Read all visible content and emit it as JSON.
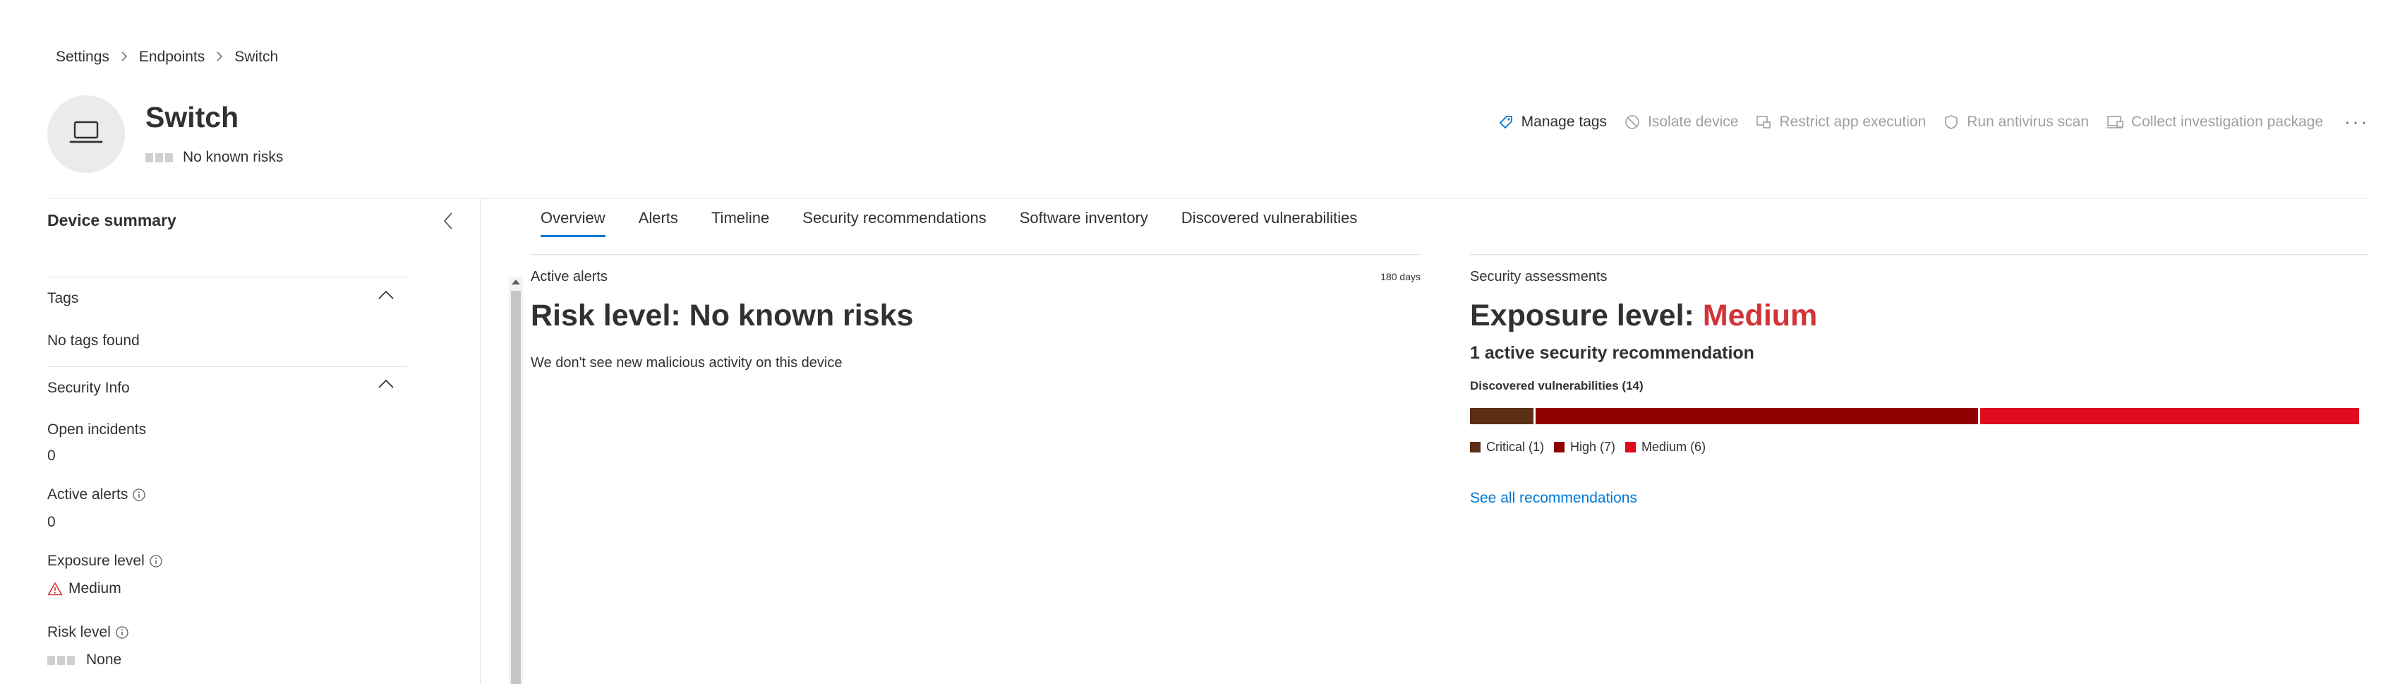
{
  "breadcrumb": [
    "Settings",
    "Endpoints",
    "Switch"
  ],
  "device": {
    "name": "Switch",
    "risk_text": "No known risks",
    "icon": "laptop-icon"
  },
  "actions": [
    {
      "label": "Manage tags",
      "icon": "tag-icon",
      "enabled": true
    },
    {
      "label": "Isolate device",
      "icon": "block-icon",
      "enabled": false
    },
    {
      "label": "Restrict app execution",
      "icon": "restrict-app-icon",
      "enabled": false
    },
    {
      "label": "Run antivirus scan",
      "icon": "shield-icon",
      "enabled": false
    },
    {
      "label": "Collect investigation package",
      "icon": "package-icon",
      "enabled": false
    }
  ],
  "more_label": "···",
  "sidebar": {
    "title": "Device summary",
    "tags": {
      "title": "Tags",
      "empty_text": "No tags found"
    },
    "security_info": {
      "title": "Security Info",
      "open_incidents_label": "Open incidents",
      "open_incidents_value": "0",
      "active_alerts_label": "Active alerts",
      "active_alerts_value": "0",
      "exposure_level_label": "Exposure level",
      "exposure_level_value": "Medium",
      "risk_level_label": "Risk level",
      "risk_level_value": "None"
    }
  },
  "tabs": [
    "Overview",
    "Alerts",
    "Timeline",
    "Security recommendations",
    "Software inventory",
    "Discovered vulnerabilities"
  ],
  "active_tab": "Overview",
  "alerts_card": {
    "label": "Active alerts",
    "period": "180 days",
    "heading": "Risk level: No known risks",
    "body": "We don't see new malicious activity on this device"
  },
  "security_card": {
    "label": "Security assessments",
    "exposure_prefix": "Exposure level: ",
    "exposure_value": "Medium",
    "recommendation": "1 active security recommendation",
    "vulnerabilities_label": "Discovered vulnerabilities (14)",
    "vulnerabilities": [
      {
        "label": "Critical (1)",
        "count": 1,
        "color": "#5c2e15"
      },
      {
        "label": "High (7)",
        "count": 7,
        "color": "#8f0000"
      },
      {
        "label": "Medium (6)",
        "count": 6,
        "color": "#e00b1c"
      }
    ],
    "see_all_label": "See all recommendations"
  },
  "colors": {
    "accent": "#0078d4",
    "exposure_medium": "#d13438",
    "text": "#323130"
  }
}
